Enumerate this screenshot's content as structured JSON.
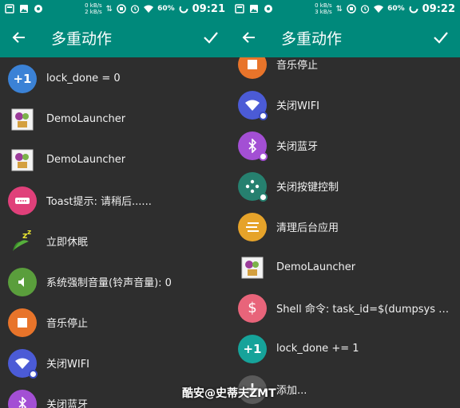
{
  "colors": {
    "teal": "#00897b",
    "blue": "#3b82d6",
    "pink": "#e0407a",
    "green": "#5a9e3c",
    "orange": "#e8742a",
    "indigo": "#4b5bd6",
    "purple": "#a34fd4",
    "dark_teal": "#26806f",
    "amber": "#e6a32a",
    "rose": "#e8647a",
    "cyan": "#16a39a"
  },
  "left": {
    "status": {
      "speed_up": "0 kB/s",
      "speed_down": "2 kB/s",
      "battery": "60%",
      "time": "09:21"
    },
    "toolbar": {
      "title": "多重动作"
    },
    "items": [
      {
        "label": "lock_done = 0",
        "icon": "plus-one-icon",
        "glyph": "+1"
      },
      {
        "label": "DemoLauncher",
        "icon": "app-launcher-icon"
      },
      {
        "label": "DemoLauncher",
        "icon": "app-launcher-icon"
      },
      {
        "label": "Toast提示: 请稍后......",
        "icon": "toast-icon"
      },
      {
        "label": "立即休眠",
        "icon": "sleep-zzz-icon"
      },
      {
        "label": "系统强制音量(铃声音量): 0",
        "icon": "volume-icon"
      },
      {
        "label": "音乐停止",
        "icon": "stop-icon"
      },
      {
        "label": "关闭WIFI",
        "icon": "wifi-icon"
      },
      {
        "label": "关闭蓝牙",
        "icon": "bluetooth-icon"
      }
    ]
  },
  "right": {
    "status": {
      "speed_up": "0 kB/s",
      "speed_down": "3 kB/s",
      "battery": "60%",
      "time": "09:22"
    },
    "toolbar": {
      "title": "多重动作"
    },
    "items": [
      {
        "label": "音乐停止",
        "icon": "stop-icon"
      },
      {
        "label": "关闭WIFI",
        "icon": "wifi-icon"
      },
      {
        "label": "关闭蓝牙",
        "icon": "bluetooth-icon"
      },
      {
        "label": "关闭按键控制",
        "icon": "gamepad-icon"
      },
      {
        "label": "清理后台应用",
        "icon": "clean-icon"
      },
      {
        "label": "DemoLauncher",
        "icon": "app-launcher-icon"
      },
      {
        "label": "Shell 命令: task_id=$(dumpsys activi...",
        "icon": "dollar-icon",
        "glyph": "$"
      },
      {
        "label": "lock_done += 1",
        "icon": "plus-one-icon",
        "glyph": "+1"
      },
      {
        "label": "添加...",
        "icon": "add-icon",
        "glyph": "+"
      }
    ]
  },
  "watermark": "酷安@史蒂夫ZMT"
}
